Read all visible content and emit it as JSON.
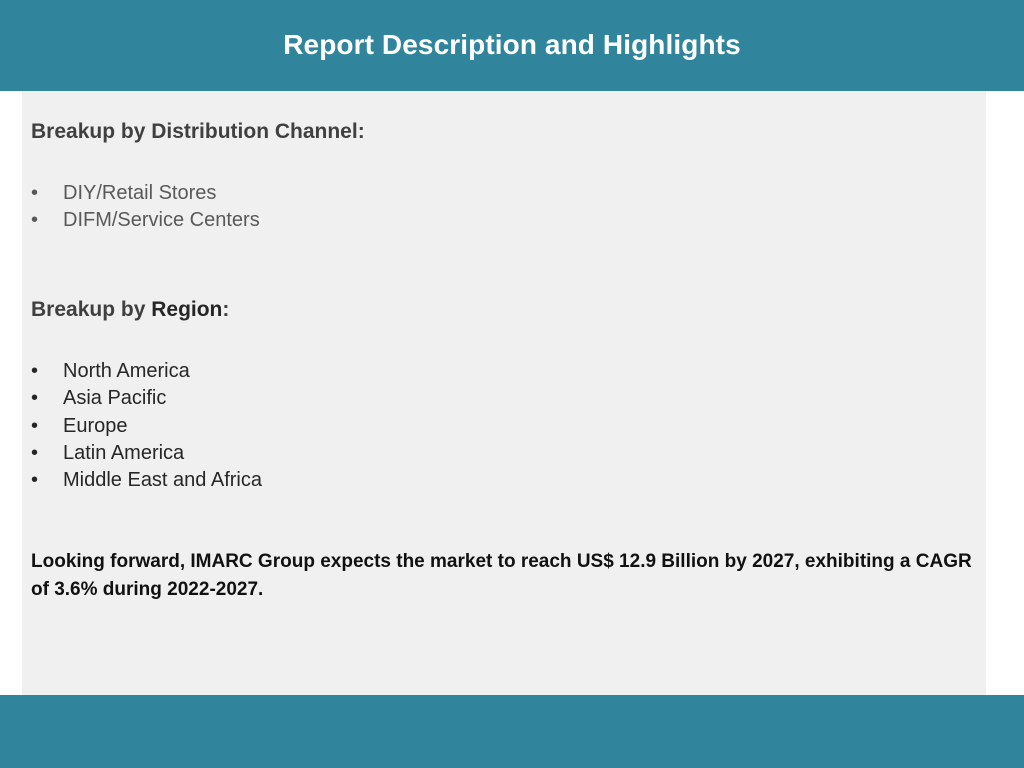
{
  "header": {
    "title": "Report Description and Highlights"
  },
  "distribution": {
    "heading": "Breakup by Distribution Channel:",
    "items": [
      "DIY/Retail Stores",
      "DIFM/Service Centers"
    ]
  },
  "region": {
    "heading_prefix": "Breakup by ",
    "heading_emphasis": "Region",
    "heading_suffix": ":",
    "items": [
      "North America",
      "Asia Pacific",
      "Europe",
      "Latin America",
      "Middle East and Africa"
    ]
  },
  "summary": "Looking forward, IMARC Group expects the market to reach US$ 12.9 Billion by 2027, exhibiting a CAGR of 3.6% during 2022-2027.",
  "bullet_symbol": "•",
  "colors": {
    "band": "#30859c",
    "panel": "#f0f0f0"
  }
}
